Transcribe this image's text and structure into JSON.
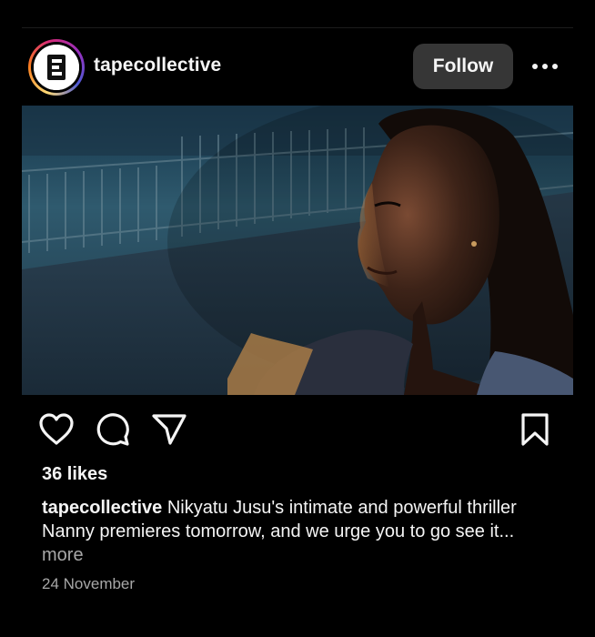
{
  "post": {
    "username": "tapecollective",
    "follow_label": "Follow",
    "likes": "36 likes",
    "caption_user": "tapecollective",
    "caption_text": "Nikyatu Jusu's intimate and powerful thriller Nanny premieres tomorrow, and we urge you to go see it...",
    "caption_more": "more",
    "date": "24 November"
  },
  "icons": {
    "avatar": "tape-collective-logo",
    "more": "more-options-icon",
    "like": "heart-icon",
    "comment": "comment-icon",
    "share": "share-icon",
    "save": "bookmark-icon"
  },
  "colors": {
    "background": "#000000",
    "text": "#f5f5f5",
    "secondary_text": "#a8a8a8",
    "follow_button": "#363636"
  }
}
